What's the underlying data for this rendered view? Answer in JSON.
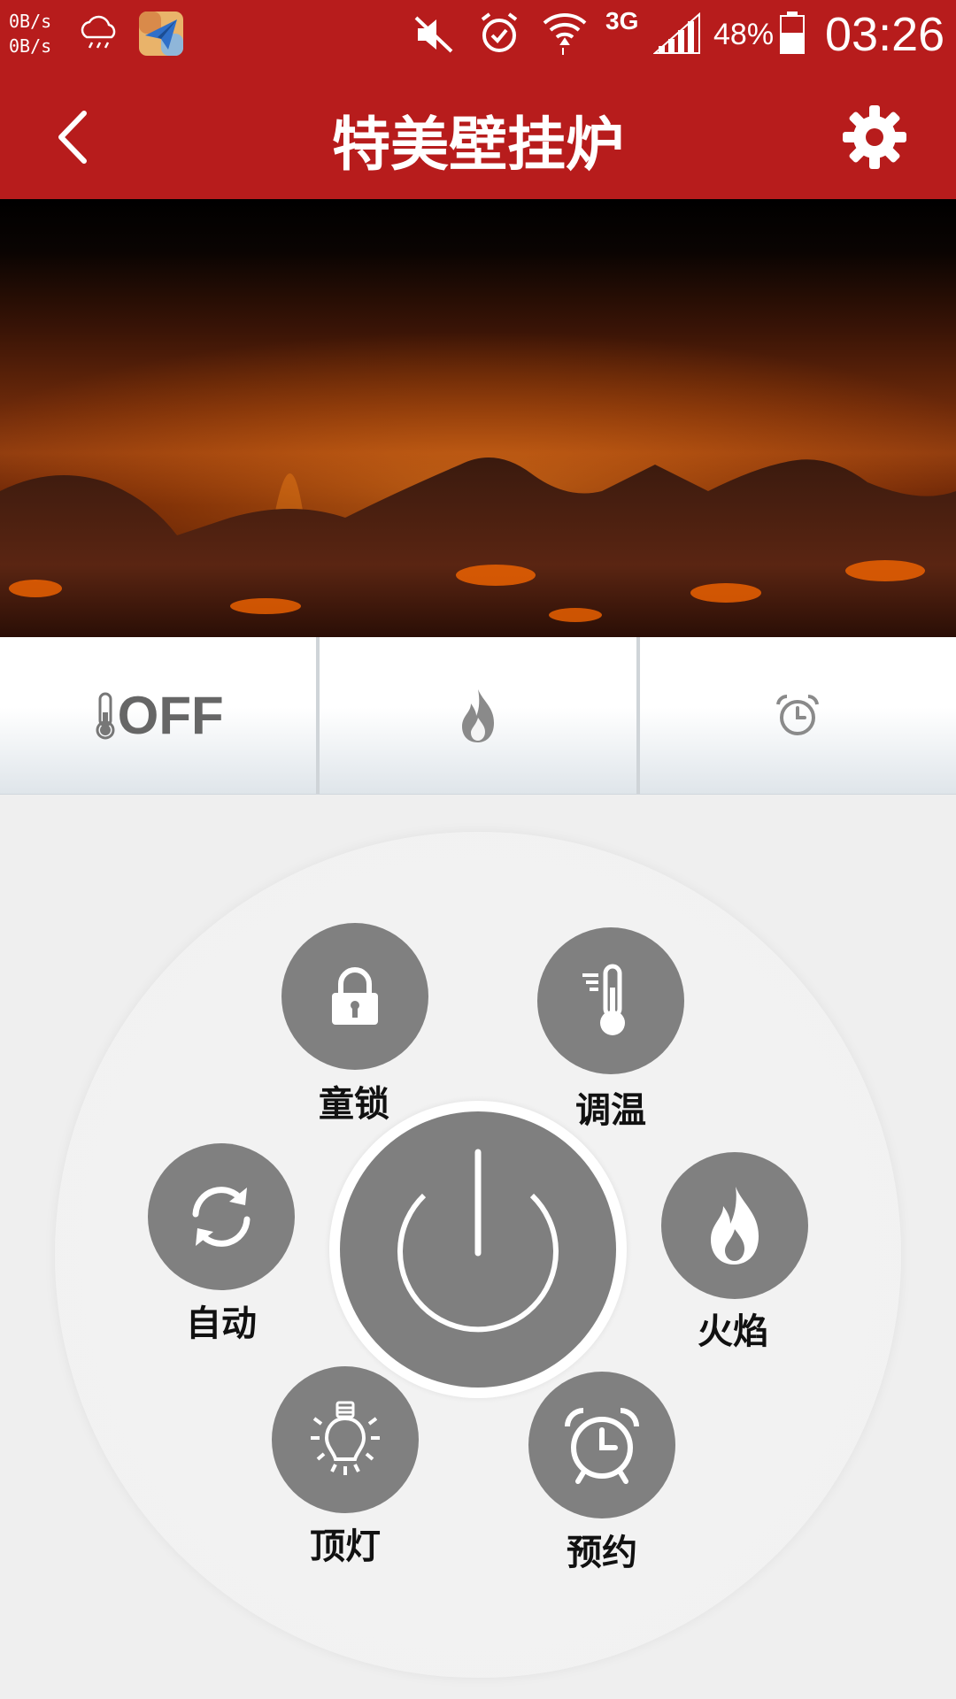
{
  "status_bar": {
    "speed_up": "0B/s",
    "speed_down": "0B/s",
    "network": "3G",
    "battery": "48%",
    "time": "03:26",
    "icons": [
      "cloud-rain-icon",
      "paper-plane-app-icon",
      "mute-icon",
      "alarm-icon",
      "wifi-icon",
      "signal-icon",
      "battery-icon"
    ]
  },
  "app_bar": {
    "title": "特美壁挂炉",
    "back_icon": "chevron-left-icon",
    "settings_icon": "gear-icon"
  },
  "status_tabs": {
    "temperature": "OFF",
    "icons": [
      "thermometer-icon",
      "flame-icon",
      "alarm-clock-icon"
    ]
  },
  "controls": {
    "child_lock": "童锁",
    "adjust_temp": "调温",
    "auto": "自动",
    "flame": "火焰",
    "top_light": "顶灯",
    "schedule": "预约",
    "power_icon": "power-icon"
  },
  "colors": {
    "brand_red": "#b71c1c",
    "button_gray": "#808080",
    "background": "#efefef"
  }
}
